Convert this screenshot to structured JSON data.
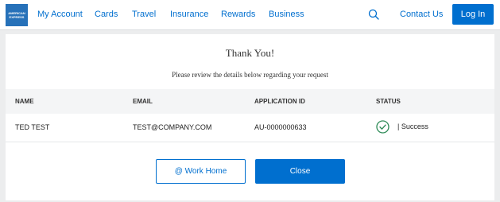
{
  "header": {
    "logo_lines": [
      "AMERICAN",
      "EXPRESS"
    ],
    "nav": [
      "My Account",
      "Cards",
      "Travel",
      "Insurance",
      "Rewards",
      "Business"
    ],
    "search_icon": "search-icon",
    "contact_label": "Contact Us",
    "login_label": "Log In"
  },
  "main": {
    "title": "Thank You!",
    "subtitle": "Please review the details below regarding your request",
    "columns": [
      "NAME",
      "EMAIL",
      "APPLICATION ID",
      "STATUS"
    ],
    "row": {
      "name": "TED TEST",
      "email": "TEST@COMPANY.COM",
      "application_id": "AU-0000000633",
      "status_icon": "check-circle-icon",
      "status": "| Success"
    },
    "work_home_label": "@ Work Home",
    "close_label": "Close"
  },
  "colors": {
    "brand_blue": "#006fcf",
    "logo_blue": "#2671b9",
    "success_green": "#2e8b57",
    "page_bg": "#ecedee"
  }
}
